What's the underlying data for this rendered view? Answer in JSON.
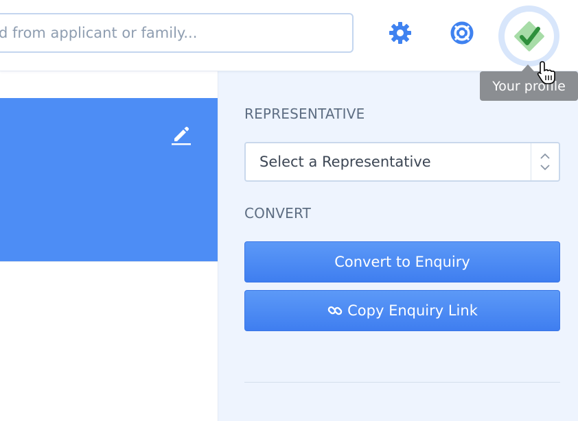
{
  "header": {
    "search_placeholder": "d from applicant or family...",
    "settings_icon": "gear-icon",
    "help_icon": "lifebuoy-icon",
    "profile_tooltip": "Your profile"
  },
  "sidebar": {
    "representative_label": "REPRESENTATIVE",
    "representative_select": "Select a Representative",
    "convert_label": "CONVERT",
    "convert_button": "Convert to Enquiry",
    "copy_link_button": "Copy Enquiry Link"
  },
  "colors": {
    "accent": "#4d8df5",
    "button": "#4585f2",
    "sidebar_bg": "#eef4fe",
    "tooltip_bg": "#8b8e92",
    "avatar_green": "#3aa33a"
  }
}
